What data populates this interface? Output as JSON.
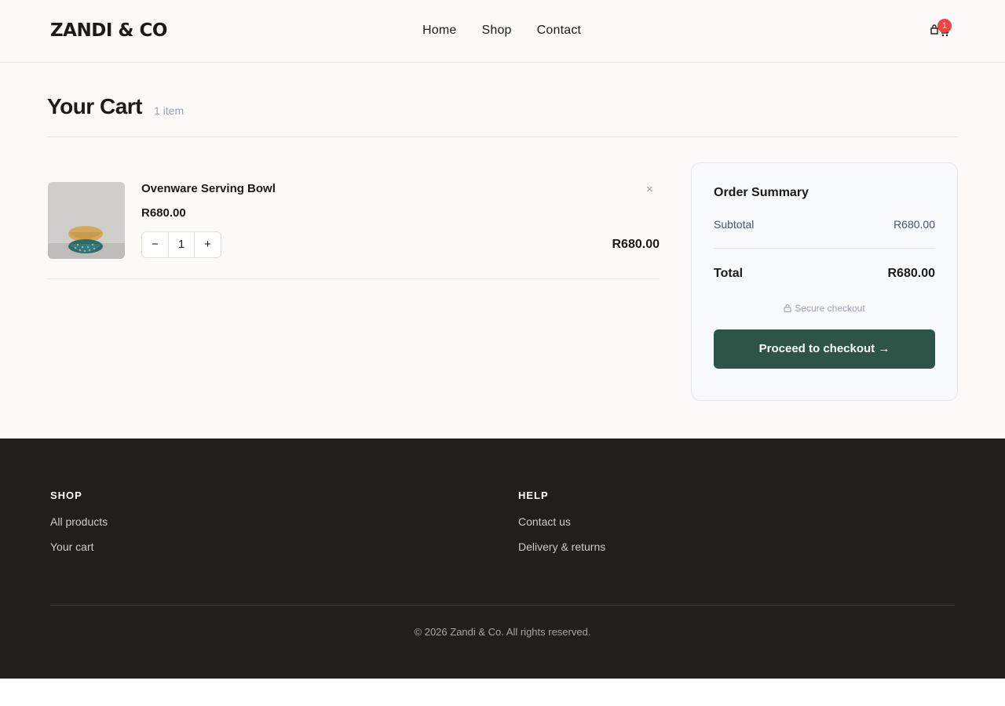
{
  "brand": {
    "logo": "ZANDI & CO",
    "accent": "#2d5446",
    "badge_color": "#ef4444"
  },
  "nav": {
    "items": [
      "Home",
      "Shop",
      "Contact"
    ]
  },
  "cart_badge": "1",
  "page": {
    "title": "Your Cart",
    "count": "1 item"
  },
  "cart": {
    "items": [
      {
        "name": "Ovenware Serving Bowl",
        "price": "R680.00",
        "quantity": "1",
        "line_total": "R680.00",
        "remove": "×",
        "minus": "−",
        "plus": "+"
      }
    ]
  },
  "summary": {
    "title": "Order Summary",
    "subtotal_label": "Subtotal",
    "subtotal_value": "R680.00",
    "total_label": "Total",
    "total_value": "R680.00",
    "secure": "Secure checkout",
    "checkout_button": "Proceed to checkout →"
  },
  "footer": {
    "columns": [
      {
        "heading": "SHOP",
        "links": [
          "All products",
          "Your cart"
        ]
      },
      {
        "heading": "HELP",
        "links": [
          "Contact us",
          "Delivery & returns"
        ]
      }
    ],
    "copyright": "© 2026 Zandi & Co. All rights reserved."
  }
}
